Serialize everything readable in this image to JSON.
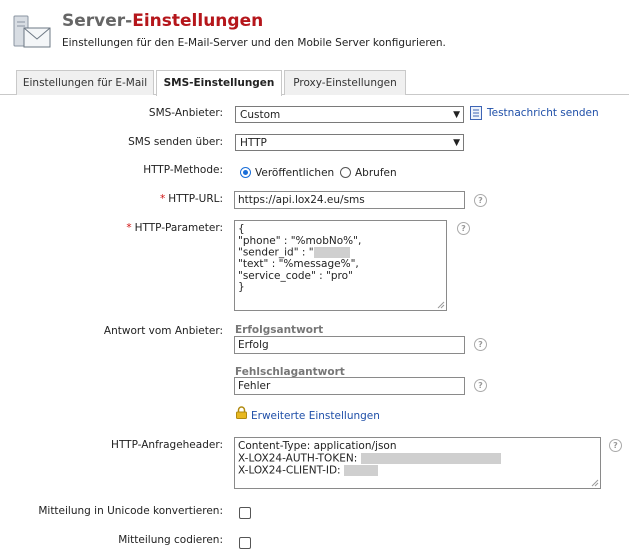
{
  "header": {
    "title_part1": "Server-",
    "title_part2": "Einstellungen",
    "subtitle": "Einstellungen für den E-Mail-Server und den Mobile Server konfigurieren."
  },
  "tabs": [
    {
      "label": "Einstellungen für E-Mail",
      "active": false
    },
    {
      "label": "SMS-Einstellungen",
      "active": true
    },
    {
      "label": "Proxy-Einstellungen",
      "active": false
    }
  ],
  "form": {
    "sms_provider": {
      "label": "SMS-Anbieter:",
      "value": "Custom",
      "test_link": "Testnachricht senden"
    },
    "send_via": {
      "label": "SMS senden über:",
      "value": "HTTP"
    },
    "http_method": {
      "label": "HTTP-Methode:",
      "options": [
        "Veröffentlichen",
        "Abrufen"
      ],
      "selected": "Veröffentlichen"
    },
    "http_url": {
      "label": "HTTP-URL:",
      "value": "https://api.lox24.eu/sms",
      "required_mark": "*"
    },
    "http_params": {
      "label": "HTTP-Parameter:",
      "required_mark": "*",
      "lines": [
        "{",
        "\"phone\" : \"%mobNo%\",",
        "\"sender_id\" : \"",
        "\"text\" : \"%message%\",",
        "\"service_code\" : \"pro\"",
        "}"
      ]
    },
    "provider_response": {
      "label": "Antwort vom Anbieter:",
      "success_label": "Erfolgsantwort",
      "success_value": "Erfolg",
      "failure_label": "Fehlschlagantwort",
      "failure_value": "Fehler"
    },
    "advanced_link": "Erweiterte Einstellungen",
    "http_headers": {
      "label": "HTTP-Anfrageheader:",
      "lines": [
        "Content-Type: application/json",
        "X-LOX24-AUTH-TOKEN: ",
        "X-LOX24-CLIENT-ID: "
      ]
    },
    "unicode": {
      "label": "Mitteilung in Unicode konvertieren:",
      "checked": false
    },
    "encode": {
      "label": "Mitteilung codieren:",
      "checked": false
    }
  },
  "help_glyph": "?",
  "colors": {
    "accent": "#b5161b",
    "link": "#1f4fa8",
    "required": "#d01010",
    "radio": "#1a6ed8"
  }
}
